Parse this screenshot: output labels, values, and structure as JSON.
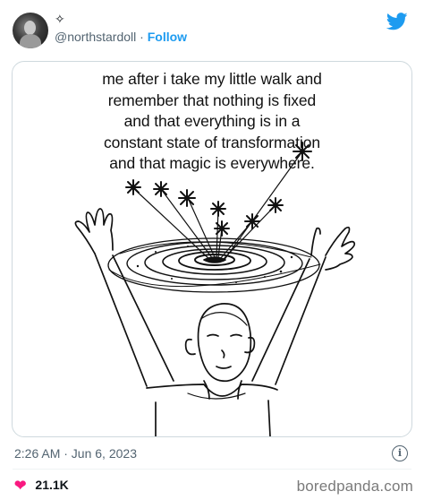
{
  "author": {
    "display_name": "✧",
    "handle": "@northstardoll",
    "separator": "·",
    "follow_label": "Follow"
  },
  "media": {
    "caption": "me after i take my little walk and\nremember that nothing is fixed\nand that everything is in a\nconstant state of transformation\nand that magic is everywhere."
  },
  "tweet": {
    "timestamp": "2:26 AM · Jun 6, 2023",
    "likes": "21.1K"
  },
  "watermark": "boredpanda.com",
  "colors": {
    "accent": "#1d9bf0",
    "like": "#f91880",
    "muted_text": "#536471"
  },
  "icons": [
    "avatar",
    "twitter-bird-icon",
    "info-icon",
    "heart-icon"
  ]
}
